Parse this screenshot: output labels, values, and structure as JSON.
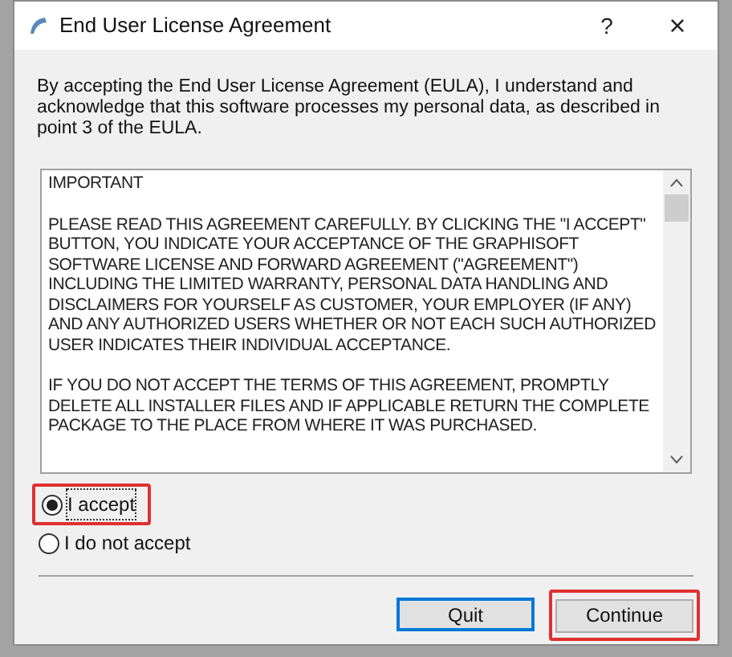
{
  "window": {
    "title": "End User License Agreement",
    "help_button": "?",
    "close_button": "×"
  },
  "intro": "By accepting the End User License Agreement (EULA), I understand and acknowledge that this software processes my personal data, as described in point 3 of the EULA.",
  "license_text": [
    "IMPORTANT",
    "PLEASE READ THIS AGREEMENT CAREFULLY. BY CLICKING THE \"I ACCEPT\" BUTTON, YOU INDICATE YOUR ACCEPTANCE OF THE GRAPHISOFT SOFTWARE LICENSE AND FORWARD AGREEMENT (\"AGREEMENT\") INCLUDING THE LIMITED WARRANTY, PERSONAL DATA HANDLING AND DISCLAIMERS FOR YOURSELF AS CUSTOMER, YOUR EMPLOYER (IF ANY) AND ANY AUTHORIZED USERS WHETHER OR NOT EACH SUCH AUTHORIZED USER INDICATES THEIR INDIVIDUAL ACCEPTANCE.",
    "IF YOU DO NOT ACCEPT THE TERMS OF THIS AGREEMENT, PROMPTLY DELETE ALL INSTALLER FILES AND IF APPLICABLE RETURN THE COMPLETE PACKAGE TO THE PLACE FROM WHERE IT WAS PURCHASED."
  ],
  "options": [
    {
      "label": "I accept",
      "selected": true,
      "highlighted": true
    },
    {
      "label": "I do not accept",
      "selected": false,
      "highlighted": false
    }
  ],
  "buttons": [
    {
      "label": "Quit",
      "focused": true,
      "highlighted": false
    },
    {
      "label": "Continue",
      "focused": false,
      "highlighted": true
    }
  ]
}
